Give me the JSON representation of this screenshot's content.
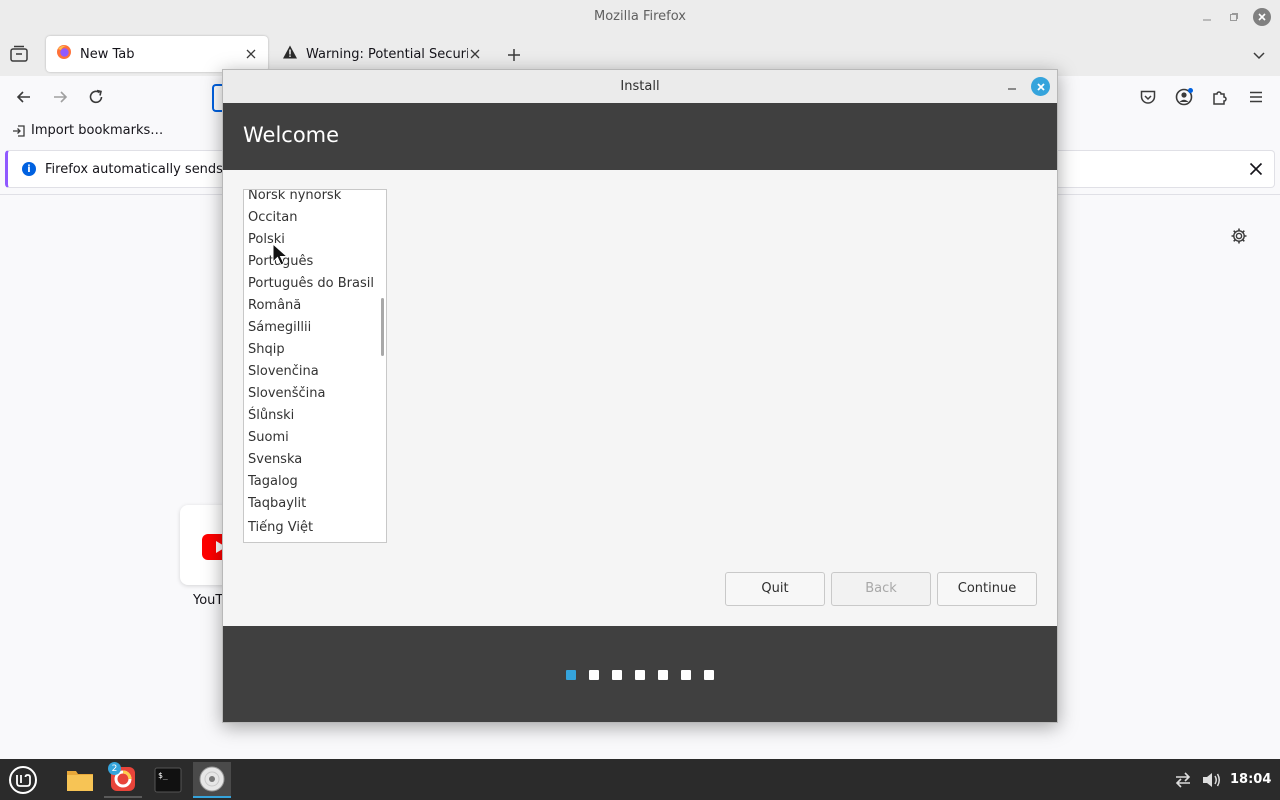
{
  "firefox": {
    "window_title": "Mozilla Firefox",
    "tabs": [
      {
        "label": "New Tab",
        "active": true
      },
      {
        "label": "Warning: Potential Security",
        "active": false
      }
    ],
    "bookmarks_bar": {
      "import_label": "Import bookmarks…"
    },
    "notification": {
      "text": "Firefox automatically sends so"
    },
    "shortcut_tile": {
      "label": "YouT"
    }
  },
  "installer": {
    "window_title": "Install",
    "heading": "Welcome",
    "languages": [
      "Norsk nynorsk",
      "Occitan",
      "Polski",
      "Português",
      "Português do Brasil",
      "Română",
      "Sámegillii",
      "Shqip",
      "Slovenčina",
      "Slovenščina",
      "Ślůnski",
      "Suomi",
      "Svenska",
      "Tagalog",
      "Taqbaylit",
      "Tiếng Việt"
    ],
    "buttons": {
      "quit": "Quit",
      "back": "Back",
      "continue": "Continue"
    },
    "steps": {
      "total": 7,
      "current": 1
    }
  },
  "taskbar": {
    "firefox_badge": "2",
    "clock": "18:04"
  },
  "colors": {
    "accent": "#35a4dc",
    "installer_header_bg": "#404040",
    "firefox_link_blue": "#0061e0"
  },
  "icons": [
    "firefox-icon",
    "warning-icon",
    "mint-menu-icon",
    "folder-icon",
    "terminal-icon",
    "disc-icon",
    "network-icon",
    "volume-icon"
  ]
}
